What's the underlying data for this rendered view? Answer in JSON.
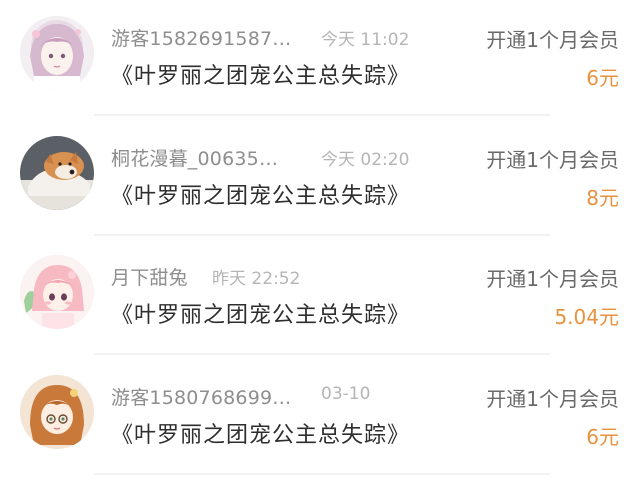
{
  "records": [
    {
      "username": "游客1582691587…",
      "time": "今天 11:02",
      "title": "《叶罗丽之团宠公主总失踪》",
      "action": "开通1个月会员",
      "price": "6元",
      "avatar_icon": "anime-girl-pink-hair-avatar"
    },
    {
      "username": "桐花漫暮_00635…",
      "time": "今天 02:20",
      "title": "《叶罗丽之团宠公主总失踪》",
      "action": "开通1个月会员",
      "price": "8元",
      "avatar_icon": "shiba-dog-avatar"
    },
    {
      "username": "月下甜兔",
      "time": "昨天 22:52",
      "title": "《叶罗丽之团宠公主总失踪》",
      "action": "开通1个月会员",
      "price": "5.04元",
      "avatar_icon": "chibi-girl-avatar"
    },
    {
      "username": "游客1580768699…",
      "time": "03-10",
      "title": "《叶罗丽之团宠公主总失踪》",
      "action": "开通1个月会员",
      "price": "6元",
      "avatar_icon": "brown-hair-anime-girl-avatar"
    }
  ],
  "colors": {
    "price": "#e8923f",
    "username": "#8e8e8e",
    "time": "#b5b5b5",
    "title": "#2e2e2e",
    "action": "#6a6a6a"
  }
}
